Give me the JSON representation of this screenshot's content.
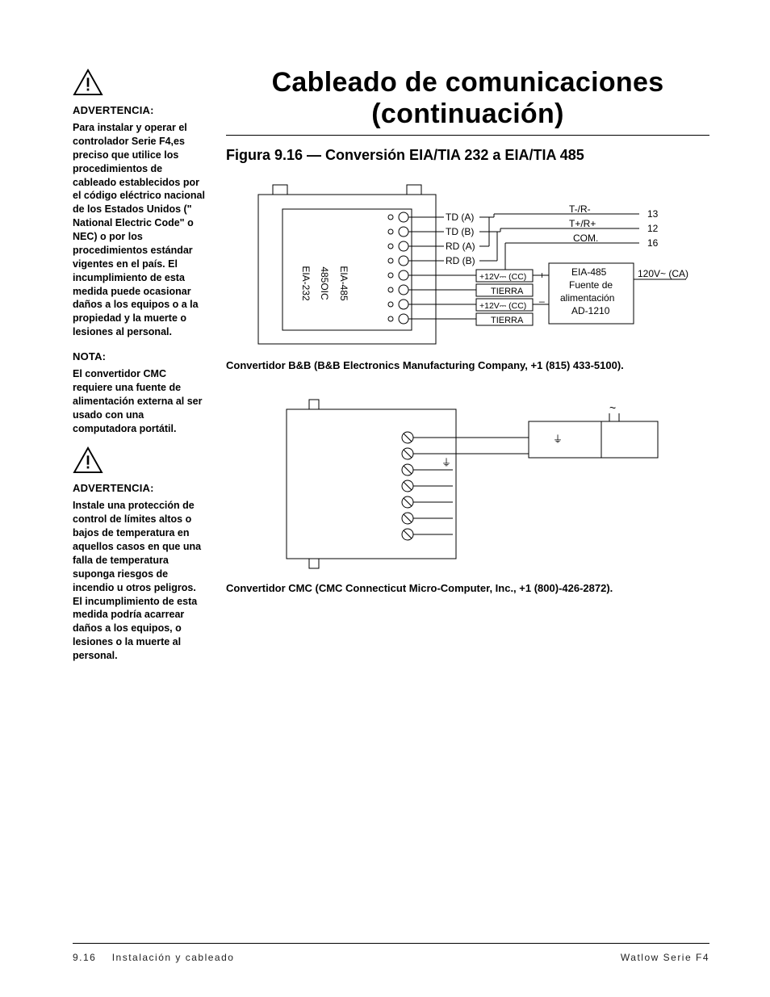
{
  "title": "Cableado de comunicaciones (continuación)",
  "figure_heading": "Figura 9.16 — Conversión EIA/TIA 232 a EIA/TIA 485",
  "sidebar": {
    "warn1_h": "ADVERTENCIA:",
    "warn1_b": "Para instalar y operar el controlador Serie F4,es preciso que utilice los procedimientos de cableado establecidos por el código eléctrico nacional de los Estados Unidos (\" National Electric Code\" o NEC) o por los procedimientos estándar vigentes en el país. El incumplimiento de esta medida puede ocasionar daños a los equipos o a la propiedad y la muerte o lesiones al personal.",
    "note_h": "NOTA:",
    "note_b": "El convertidor CMC requiere una fuente de alimentación externa al ser usado con una computadora portátil.",
    "warn2_h": "ADVERTENCIA:",
    "warn2_b": "Instale una protección de control de límites altos o bajos de temperatura en aquellos casos en que una falla de temperatura suponga riesgos de incendio u otros peligros. El incumplimiento de esta medida podría acarrear daños a los equipos, o lesiones o la muerte al personal."
  },
  "diag1": {
    "eia232": "EIA-232",
    "ic": "485OIC",
    "eia485": "EIA-485",
    "td_a": "TD (A)",
    "td_b": "TD (B)",
    "rd_a": "RD (A)",
    "rd_b": "RD (B)",
    "p12v_cc_1": "+12V⎓ (CC)",
    "tierra1": "TIERRA",
    "p12v_cc_2": "+12V⎓ (CC)",
    "tierra2": "TIERRA",
    "t_minus": "T-/R-",
    "t_plus": "T+/R+",
    "com": "COM.",
    "eia485_r": "EIA-485",
    "fuente": "Fuente de",
    "alim": "alimentación",
    "ad": "AD-1210",
    "n13": "13",
    "n12": "12",
    "n16": "16",
    "v120": "120V~ (CA)",
    "plus": "+",
    "minus": "_"
  },
  "diag2": {
    "tilde": "~",
    "ground": "⏚"
  },
  "caption1": "Convertidor B&B (B&B Electronics Manufacturing Company, +1 (815) 433-5100).",
  "caption2": "Convertidor CMC (CMC Connecticut Micro-Computer, Inc., +1 (800)-426-2872).",
  "footer": {
    "page_num": "9.16",
    "section": "Instalación y cableado",
    "brand": "Watlow Serie F4"
  }
}
